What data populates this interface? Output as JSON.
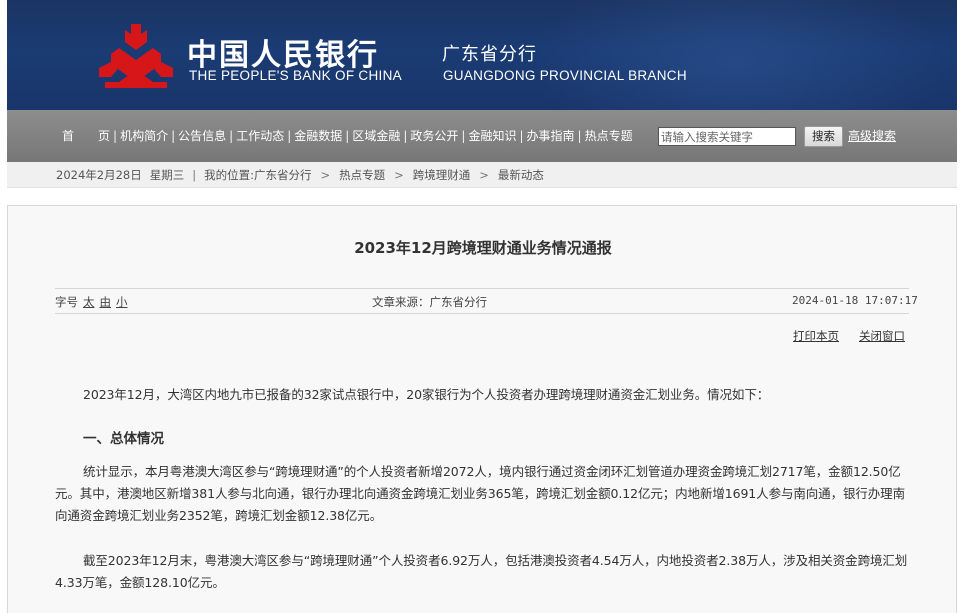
{
  "header": {
    "bank_name_cn": "中国人民银行",
    "branch_cn": "广东省分行",
    "bank_name_en": "THE PEOPLE'S BANK OF CHINA",
    "branch_en": "GUANGDONG PROVINCIAL BRANCH",
    "logo_icon": "pboc-logo-icon",
    "colors": {
      "banner": "#1a3b74",
      "logo_red": "#d7161a"
    }
  },
  "nav": {
    "items": [
      "首　　页",
      "机构简介",
      "公告信息",
      "工作动态",
      "金融数据",
      "区域金融",
      "政务公开",
      "金融知识",
      "办事指南",
      "热点专题"
    ],
    "search_placeholder": "请输入搜索关键字",
    "search_button": "搜索",
    "advanced_search": "高级搜索"
  },
  "breadcrumb": {
    "date": "2024年2月28日",
    "weekday": "星期三",
    "location_label": "我的位置:",
    "path": [
      "广东省分行",
      "热点专题",
      "跨境理财通",
      "最新动态"
    ]
  },
  "article": {
    "title": "2023年12月跨境理财通业务情况通报",
    "font_size_label": "字号",
    "font_sizes": [
      "太",
      "由",
      "小"
    ],
    "source": "文章来源：广东省分行",
    "datetime": "2024-01-18 17:07:17",
    "print": "打印本页",
    "close": "关闭窗口",
    "intro": "2023年12月，大湾区内地九市已报备的32家试点银行中，20家银行为个人投资者办理跨境理财通资金汇划业务。情况如下：",
    "section1_heading": "一、总体情况",
    "para1": "统计显示，本月粤港澳大湾区参与“跨境理财通”的个人投资者新增2072人，境内银行通过资金闭环汇划管道办理资金跨境汇划2717笔，金额12.50亿元。其中，港澳地区新增381人参与北向通，银行办理北向通资金跨境汇划业务365笔，跨境汇划金额0.12亿元；内地新增1691人参与南向通，银行办理南向通资金跨境汇划业务2352笔，跨境汇划金额12.38亿元。",
    "para2": "截至2023年12月末，粤港澳大湾区参与“跨境理财通”个人投资者6.92万人，包括港澳投资者4.54万人，内地投资者2.38万人，涉及相关资金跨境汇划4.33万笔，金额128.10亿元。"
  }
}
